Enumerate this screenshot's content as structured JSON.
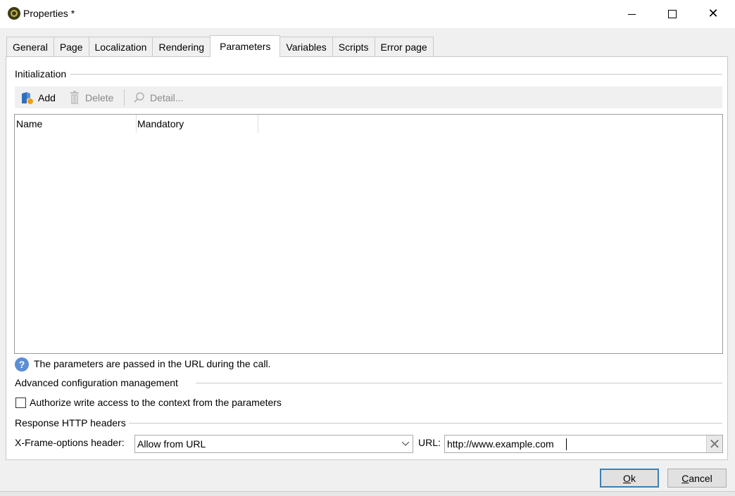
{
  "window": {
    "title": "Properties *"
  },
  "tabs": [
    {
      "label": "General"
    },
    {
      "label": "Page"
    },
    {
      "label": "Localization"
    },
    {
      "label": "Rendering"
    },
    {
      "label": "Parameters",
      "active": true
    },
    {
      "label": "Variables"
    },
    {
      "label": "Scripts"
    },
    {
      "label": "Error page"
    }
  ],
  "initialization": {
    "group_label": "Initialization",
    "toolbar": {
      "add": "Add",
      "delete": "Delete",
      "detail": "Detail..."
    },
    "columns": [
      "Name",
      "Mandatory"
    ],
    "rows": []
  },
  "info_text": "The parameters are passed in the URL during the call.",
  "advanced": {
    "group_label": "Advanced configuration management",
    "checkbox_label": "Authorize write access to the context from the parameters",
    "checked": false
  },
  "http_headers": {
    "group_label": "Response HTTP headers",
    "xframe_label": "X-Frame-options header:",
    "xframe_value": "Allow from URL",
    "url_label": "URL:",
    "url_value": "http://www.example.com"
  },
  "buttons": {
    "ok_mnemonic": "O",
    "ok_rest": "k",
    "cancel_mnemonic": "C",
    "cancel_rest": "ancel"
  },
  "colors": {
    "accent": "#3c7fb1",
    "info": "#5b8ed5",
    "add_icon": "#2f6fba"
  }
}
